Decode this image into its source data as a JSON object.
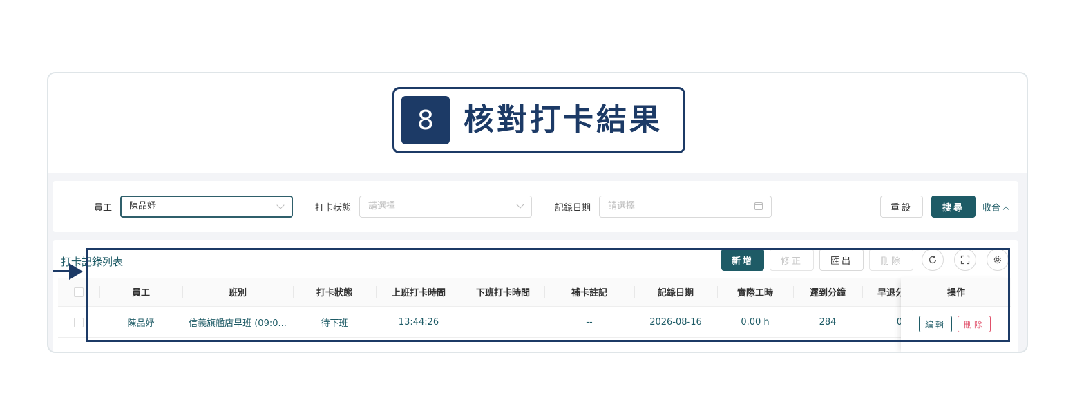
{
  "banner": {
    "step_number": "8",
    "title": "核對打卡結果"
  },
  "filters": {
    "employee": {
      "label": "員工",
      "value": "陳品妤"
    },
    "status": {
      "label": "打卡狀態",
      "placeholder": "請選擇"
    },
    "date": {
      "label": "記錄日期",
      "placeholder": "請選擇"
    },
    "reset_label": "重設",
    "search_label": "搜尋",
    "collapse_label": "收合"
  },
  "table": {
    "title": "打卡記錄列表",
    "toolbar": {
      "add": "新增",
      "edit": "修正",
      "export": "匯出",
      "delete": "刪除"
    },
    "columns": [
      "員工",
      "班別",
      "打卡狀態",
      "上班打卡時間",
      "下班打卡時間",
      "補卡註記",
      "記錄日期",
      "實際工時",
      "遲到分鐘",
      "早退分",
      "操作"
    ],
    "rows": [
      {
        "employee": "陳品妤",
        "shift": "信義旗艦店早班 (09:0...",
        "status": "待下班",
        "clock_in": "13:44:26",
        "clock_out": "",
        "note": "--",
        "date": "2026-08-16",
        "hours": "0.00 h",
        "late": "284",
        "early": "0",
        "edit": "編輯",
        "delete": "刪除"
      }
    ]
  },
  "colors": {
    "primary": "#1e5b66",
    "annotation": "#1c3a66",
    "danger": "#e0506a"
  }
}
